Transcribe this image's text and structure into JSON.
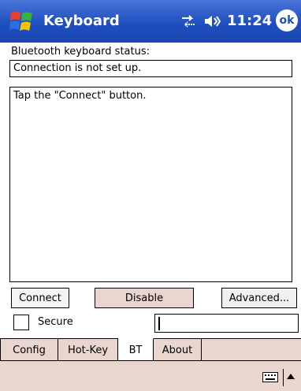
{
  "titlebar": {
    "title": "Keyboard",
    "time": "11:24",
    "ok_label": "ok"
  },
  "status": {
    "label": "Bluetooth keyboard status:",
    "value": "Connection is not set up."
  },
  "message": {
    "text": "Tap the \"Connect\" button."
  },
  "buttons": {
    "connect": "Connect",
    "disable": "Disable",
    "advanced": "Advanced..."
  },
  "secure": {
    "label": "Secure",
    "checked": false
  },
  "input": {
    "value": ""
  },
  "tabs": [
    {
      "label": "Config"
    },
    {
      "label": "Hot-Key"
    },
    {
      "label": "BT"
    },
    {
      "label": "About"
    }
  ],
  "active_tab": "BT",
  "icons": {
    "start": "windows-flag-icon",
    "connectivity": "connectivity-arrows-icon",
    "volume": "speaker-icon",
    "keyboard": "keyboard-icon",
    "sip_arrow": "up-arrow-icon"
  },
  "colors": {
    "titlebar": "#1f4fc0",
    "panel": "#e8d6cf"
  }
}
